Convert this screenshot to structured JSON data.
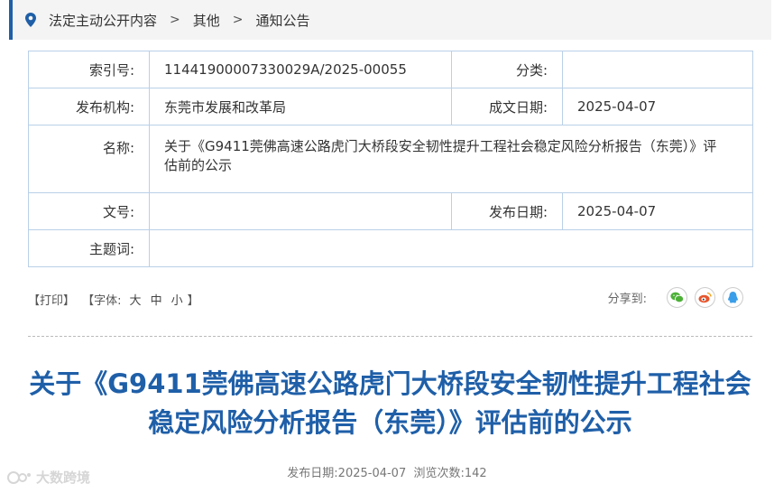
{
  "breadcrumb": [
    "法定主动公开内容",
    "其他",
    "通知公告"
  ],
  "meta": {
    "index_label": "索引号:",
    "index_value": "11441900007330029A/2025-00055",
    "category_label": "分类:",
    "category_value": "",
    "publisher_label": "发布机构:",
    "publisher_value": "东莞市发展和改革局",
    "created_label": "成文日期:",
    "created_value": "2025-04-07",
    "name_label": "名称:",
    "name_value": "关于《G9411莞佛高速公路虎门大桥段安全韧性提升工程社会稳定风险分析报告（东莞）》评估前的公示",
    "docno_label": "文号:",
    "docno_value": "",
    "pubdate_label": "发布日期:",
    "pubdate_value": "2025-04-07",
    "subject_label": "主题词:",
    "subject_value": ""
  },
  "tools": {
    "print": "【打印】",
    "font_prefix": "【字体:",
    "font_large": "大",
    "font_medium": "中",
    "font_small": "小",
    "font_suffix": "】",
    "share_label": "分享到:"
  },
  "share_icons": [
    "wechat-icon",
    "weibo-icon",
    "qq-icon"
  ],
  "colors": {
    "accent": "#1f5fa8",
    "border": "#b9d0e8",
    "wechat": "#4cb037",
    "weibo": "#e6562d",
    "qq": "#3b9ee8"
  },
  "article": {
    "title": "关于《G9411莞佛高速公路虎门大桥段安全韧性提升工程社会稳定风险分析报告（东莞）》评估前的公示",
    "pub_date_label": "发布日期:",
    "pub_date": "2025-04-07",
    "views_label": "浏览次数:",
    "views": "142"
  },
  "watermark": "大数跨境"
}
